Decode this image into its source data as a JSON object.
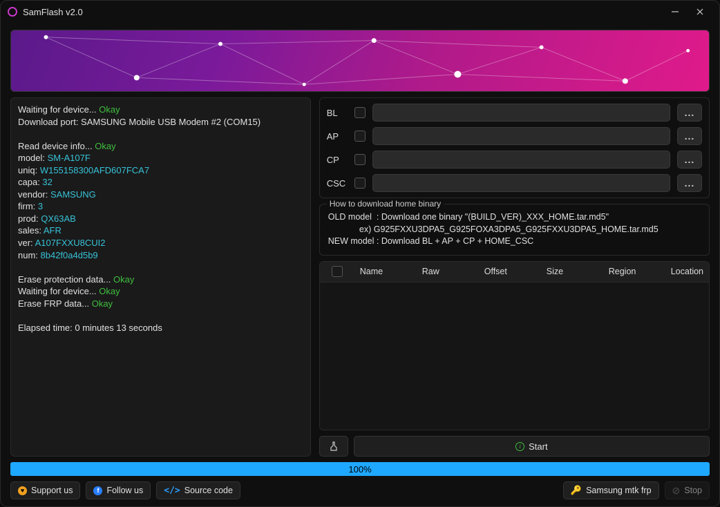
{
  "title": "SamFlash v2.0",
  "log": {
    "l1a": "Waiting for device... ",
    "l1b": "Okay",
    "l2": "Download port: SAMSUNG Mobile USB Modem #2 (COM15)",
    "l3": "",
    "l4a": "Read device info... ",
    "l4b": "Okay",
    "l5a": "model: ",
    "l5b": "SM-A107F",
    "l6a": "uniq: ",
    "l6b": "W155158300AFD607FCA7",
    "l7a": "capa: ",
    "l7b": "32",
    "l8a": "vendor: ",
    "l8b": "SAMSUNG",
    "l9a": "firm: ",
    "l9b": "3",
    "l10a": "prod: ",
    "l10b": "QX63AB",
    "l11a": "sales: ",
    "l11b": "AFR",
    "l12a": "ver: ",
    "l12b": "A107FXXU8CUI2",
    "l13a": "num: ",
    "l13b": "8b42f0a4d5b9",
    "l14": "",
    "l15a": "Erase protection data... ",
    "l15b": "Okay",
    "l16a": "Waiting for device... ",
    "l16b": "Okay",
    "l17a": "Erase FRP data... ",
    "l17b": "Okay",
    "l18": "",
    "l19": "Elapsed time: 0 minutes 13 seconds"
  },
  "slots": [
    {
      "label": "BL"
    },
    {
      "label": "AP"
    },
    {
      "label": "CP"
    },
    {
      "label": "CSC"
    }
  ],
  "howto": {
    "legend": "How to download home binary",
    "text": "OLD model  : Download one binary \"(BUILD_VER)_XXX_HOME.tar.md5\"\n             ex) G925FXXU3DPA5_G925FOXA3DPA5_G925FXXU3DPA5_HOME.tar.md5\nNEW model : Download BL + AP + CP + HOME_CSC"
  },
  "table": {
    "cols": [
      "Name",
      "Raw",
      "Offset",
      "Size",
      "Region",
      "Location"
    ]
  },
  "buttons": {
    "start": "Start",
    "browse": "..."
  },
  "progress": {
    "label": "100%",
    "value": 100
  },
  "footer": {
    "support": "Support us",
    "follow": "Follow us",
    "source": "Source code",
    "samsung": "Samsung mtk frp",
    "stop": "Stop"
  }
}
